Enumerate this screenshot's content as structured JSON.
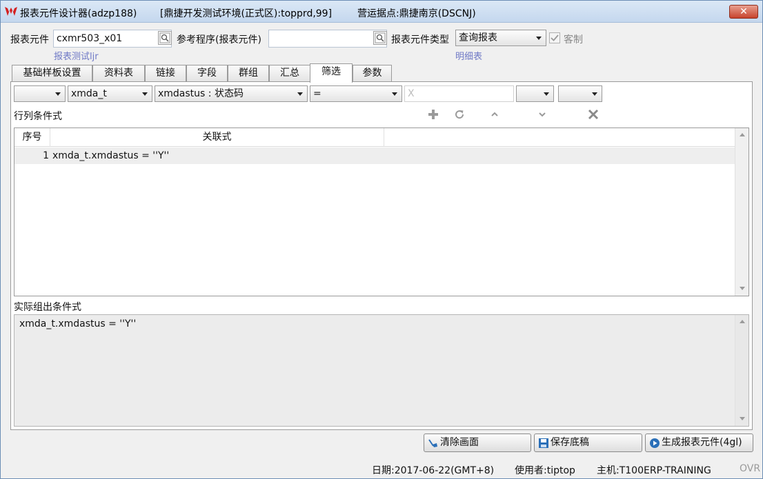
{
  "window": {
    "title_app": "报表元件设计器(adzp188)",
    "title_env": "[鼎捷开发测试环境(正式区):topprd,99]",
    "title_site": "营运据点:鼎捷南京(DSCNJ)",
    "close_label": "✕"
  },
  "header": {
    "component_label": "报表元件",
    "component_value": "cxmr503_x01",
    "component_desc": "报表测试ljr",
    "ref_program_label": "参考程序(报表元件)",
    "ref_program_value": "",
    "type_label": "报表元件类型",
    "type_value": "查询报表",
    "type_desc": "明细表",
    "custom_label": "客制",
    "custom_checked": true
  },
  "tabs": [
    {
      "label": "基础样板设置"
    },
    {
      "label": "资料表"
    },
    {
      "label": "链接"
    },
    {
      "label": "字段"
    },
    {
      "label": "群组"
    },
    {
      "label": "汇总"
    },
    {
      "label": "筛选",
      "active": true
    },
    {
      "label": "参数"
    }
  ],
  "filter": {
    "paren_open": "",
    "table": "xmda_t",
    "field": "xmdastus : 状态码",
    "operator": "=",
    "value_placeholder": "X",
    "paren_close": "",
    "logic": ""
  },
  "conditions": {
    "section_label": "行列条件式",
    "col_seq": "序号",
    "col_expr": "关联式",
    "rows": [
      {
        "seq": "1",
        "expr": "xmda_t.xmdastus = ''Y''"
      }
    ]
  },
  "actual": {
    "section_label": "实际组出条件式",
    "text": "xmda_t.xmdastus = ''Y''"
  },
  "buttons": {
    "clear": "清除画面",
    "save": "保存底稿",
    "generate": "生成报表元件(4gl)"
  },
  "status": {
    "date": "日期:2017-06-22(GMT+8)",
    "user": "使用者:tiptop",
    "host": "主机:T100ERP-TRAINING",
    "mode": "OVR"
  }
}
